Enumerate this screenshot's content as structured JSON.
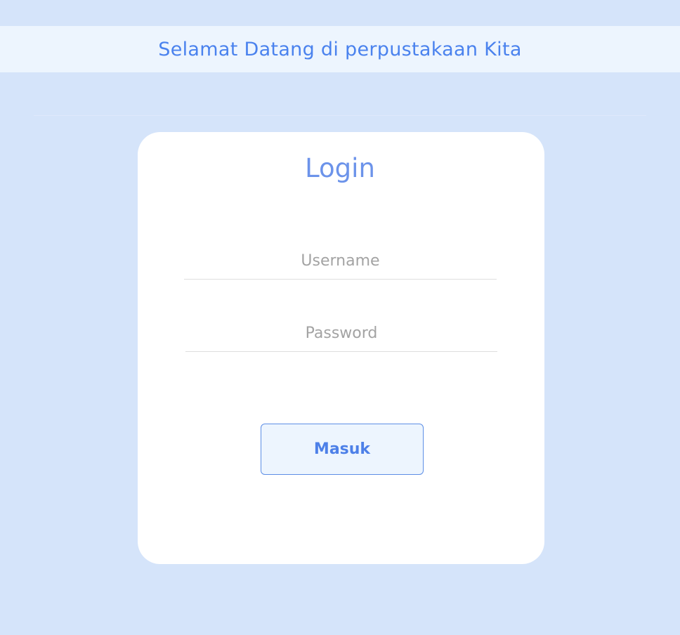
{
  "header": {
    "title": "Selamat Datang di perpustakaan Kita"
  },
  "login": {
    "title": "Login",
    "username": {
      "value": "",
      "placeholder": "Username"
    },
    "password": {
      "value": "",
      "placeholder": "Password"
    },
    "submit_label": "Masuk"
  },
  "colors": {
    "page_background": "#d5e4fa",
    "banner_background": "#edf5fe",
    "card_background": "#ffffff",
    "accent": "#4a82ee",
    "title": "#6c93ea"
  }
}
